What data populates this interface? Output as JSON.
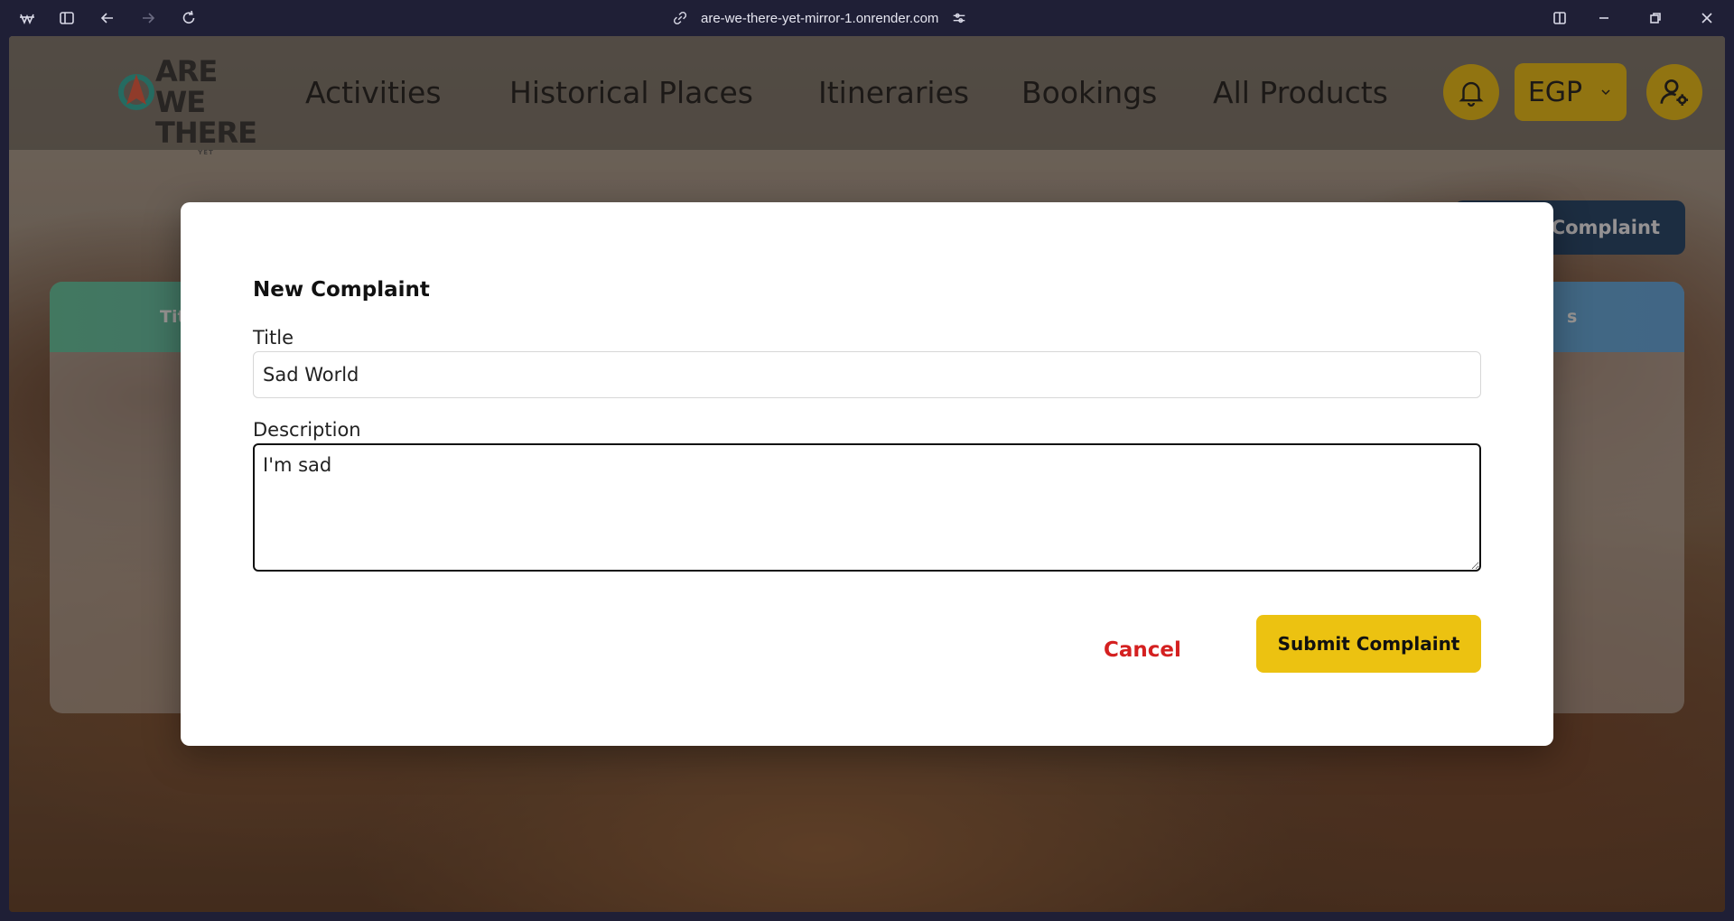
{
  "browser": {
    "url": "are-we-there-yet-mirror-1.onrender.com"
  },
  "site": {
    "logo_text_line1": "ARE WE",
    "logo_text_line2": "THERE",
    "logo_text_line3": "YET",
    "nav": [
      "Activities",
      "Historical Places",
      "Itineraries",
      "Bookings",
      "All Products"
    ],
    "currency": "EGP",
    "accent_color": "#ecc211"
  },
  "background": {
    "file_button_label": "Complaint",
    "table_header_left": "Title",
    "table_header_right": "s"
  },
  "modal": {
    "title": "New Complaint",
    "title_label": "Title",
    "title_value": "Sad World",
    "description_label": "Description",
    "description_value": "I'm sad",
    "cancel_label": "Cancel",
    "submit_label": "Submit Complaint"
  }
}
